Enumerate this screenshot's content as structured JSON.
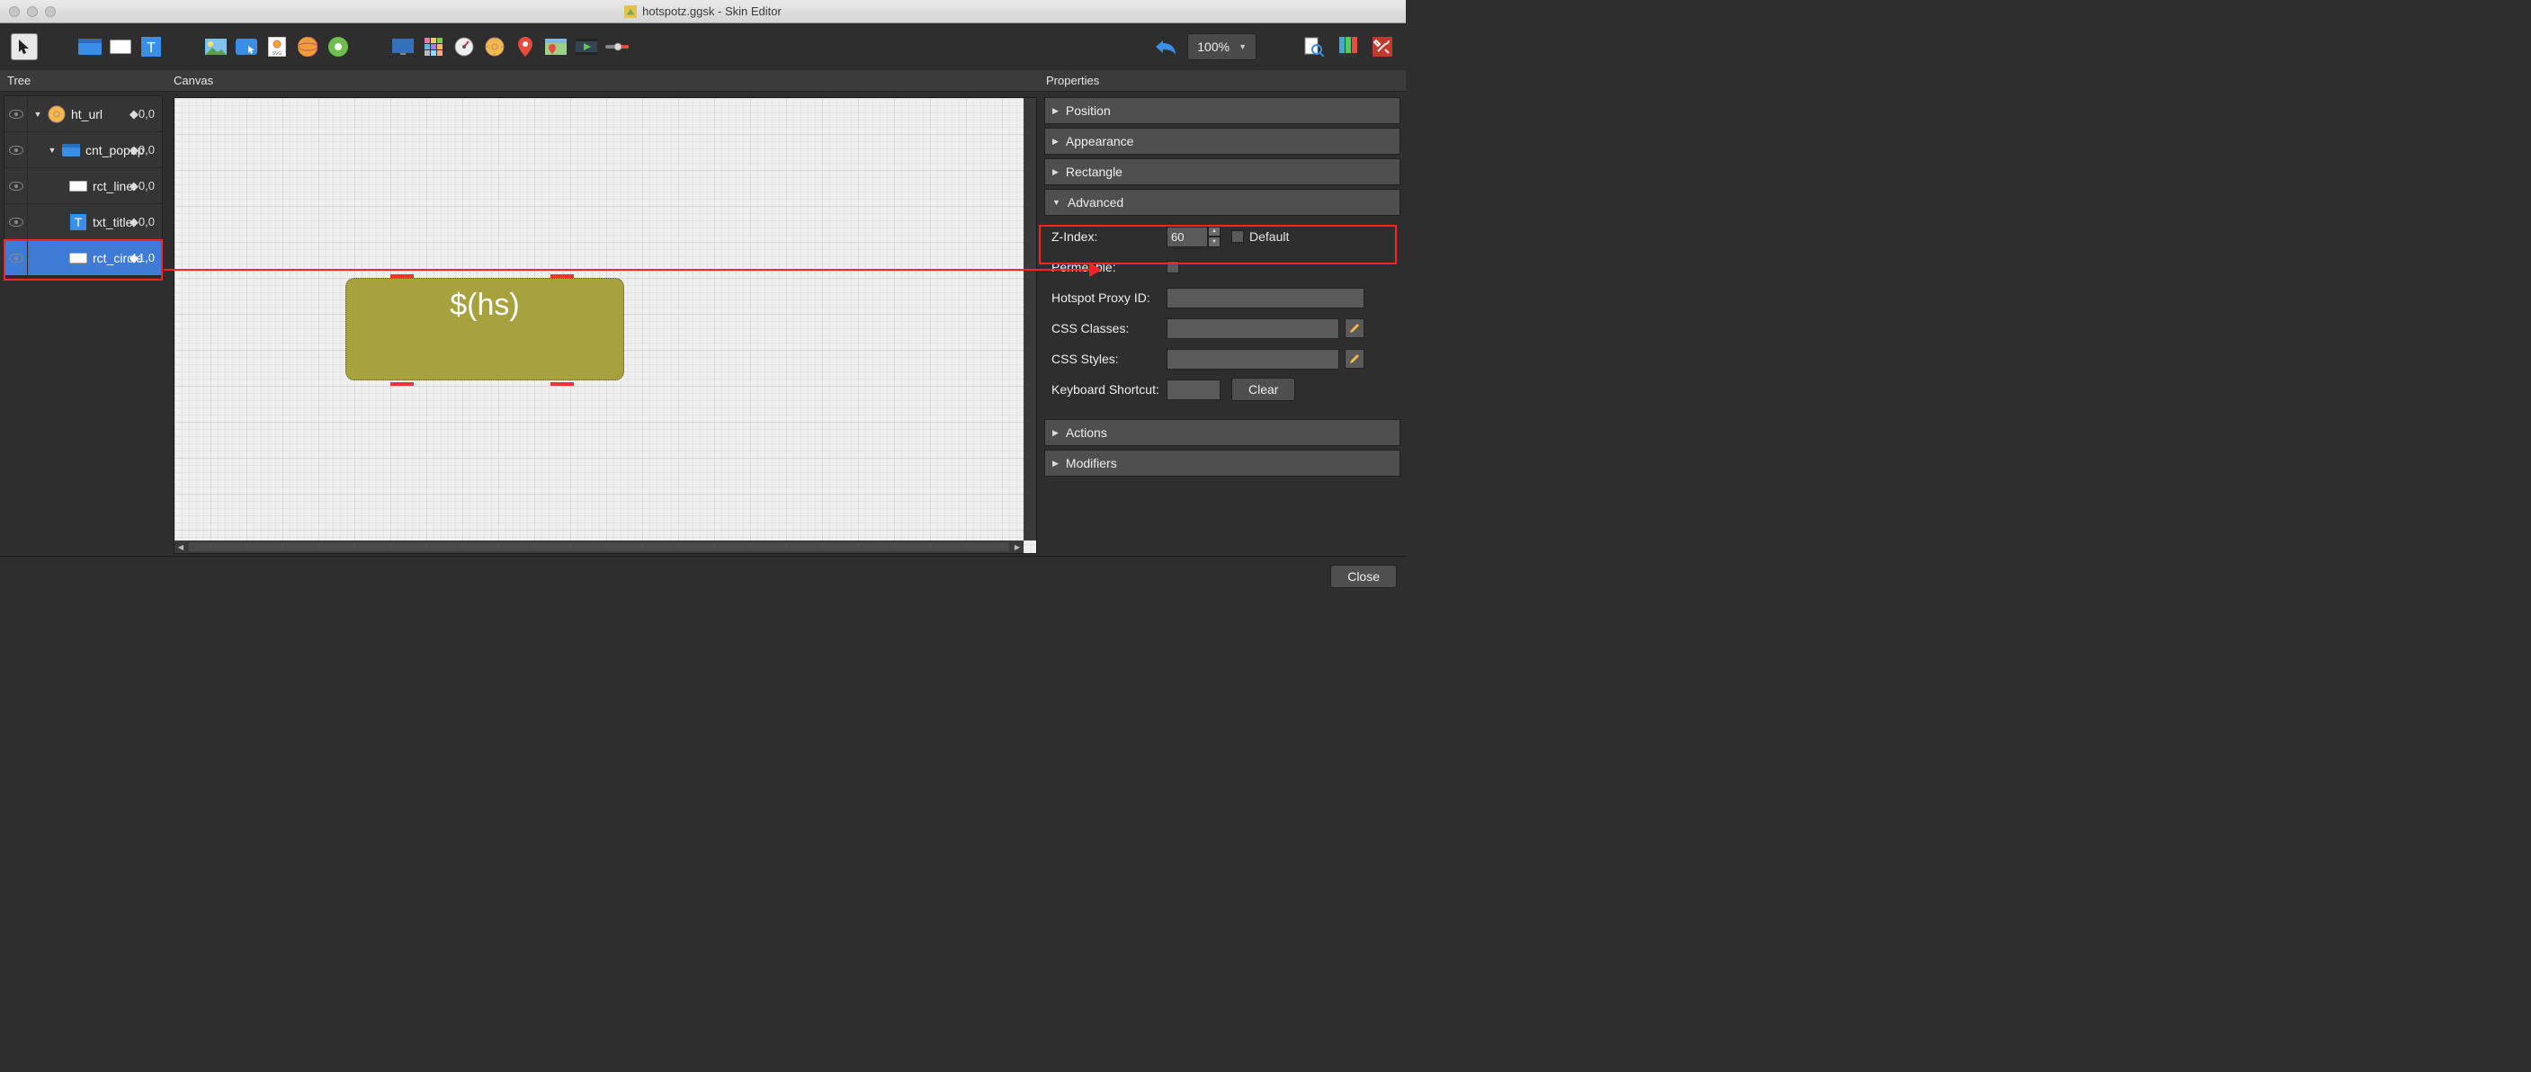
{
  "window": {
    "title": "hotspotz.ggsk - Skin Editor"
  },
  "toolbar": {
    "zoom": "100%"
  },
  "panels": {
    "tree": "Tree",
    "canvas": "Canvas",
    "properties": "Properties"
  },
  "tree": {
    "items": [
      {
        "label": "ht_url",
        "anchor": "◆0,0",
        "expanded": true,
        "indent": 1,
        "icon": "hotspot",
        "selected": false
      },
      {
        "label": "cnt_popup",
        "anchor": "◆0,0",
        "expanded": true,
        "indent": 2,
        "icon": "container",
        "selected": false
      },
      {
        "label": "rct_line",
        "anchor": "◆0,0",
        "expanded": false,
        "indent": 3,
        "icon": "rect",
        "selected": false
      },
      {
        "label": "txt_title",
        "anchor": "◆0,0",
        "expanded": false,
        "indent": 3,
        "icon": "text",
        "selected": false
      },
      {
        "label": "rct_circle",
        "anchor": "◆1,0",
        "expanded": false,
        "indent": 3,
        "icon": "rect",
        "selected": true
      }
    ]
  },
  "canvas": {
    "placeholder_text": "$(hs)"
  },
  "properties": {
    "sections": {
      "position": "Position",
      "appearance": "Appearance",
      "rectangle": "Rectangle",
      "advanced": "Advanced",
      "actions": "Actions",
      "modifiers": "Modifiers"
    },
    "advanced": {
      "zindex_label": "Z-Index:",
      "zindex_value": "60",
      "default_label": "Default",
      "permeable_label": "Permeable:",
      "hotspot_proxy_label": "Hotspot Proxy ID:",
      "hotspot_proxy_value": "",
      "css_classes_label": "CSS Classes:",
      "css_classes_value": "",
      "css_styles_label": "CSS Styles:",
      "css_styles_value": "",
      "keyboard_shortcut_label": "Keyboard Shortcut:",
      "keyboard_shortcut_value": "",
      "clear_label": "Clear"
    }
  },
  "footer": {
    "close": "Close"
  }
}
